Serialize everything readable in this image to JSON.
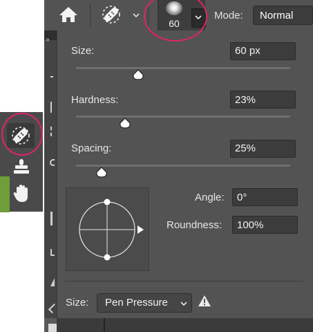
{
  "options_bar": {
    "brush_size_preview": "60",
    "mode_label": "Mode:",
    "mode_value": "Normal"
  },
  "brush_panel": {
    "size_label": "Size:",
    "size_value": "60 px",
    "size_slider_fraction": 0.29,
    "hardness_label": "Hardness:",
    "hardness_value": "23%",
    "hardness_slider_fraction": 0.23,
    "spacing_label": "Spacing:",
    "spacing_value": "25%",
    "spacing_slider_fraction": 0.12,
    "angle_label": "Angle:",
    "angle_value": "0°",
    "roundness_label": "Roundness:",
    "roundness_value": "100%",
    "pressure_size_label": "Size:",
    "pressure_control_value": "Pen Pressure"
  },
  "tools": {
    "active": "spot-healing-brush-icon",
    "flyout": [
      "spot-healing-brush-icon",
      "clone-stamp-icon",
      "hand-icon"
    ]
  },
  "colors": {
    "highlight": "#e0236c",
    "panel_bg": "#535353",
    "field_bg": "#3c3c3c"
  }
}
